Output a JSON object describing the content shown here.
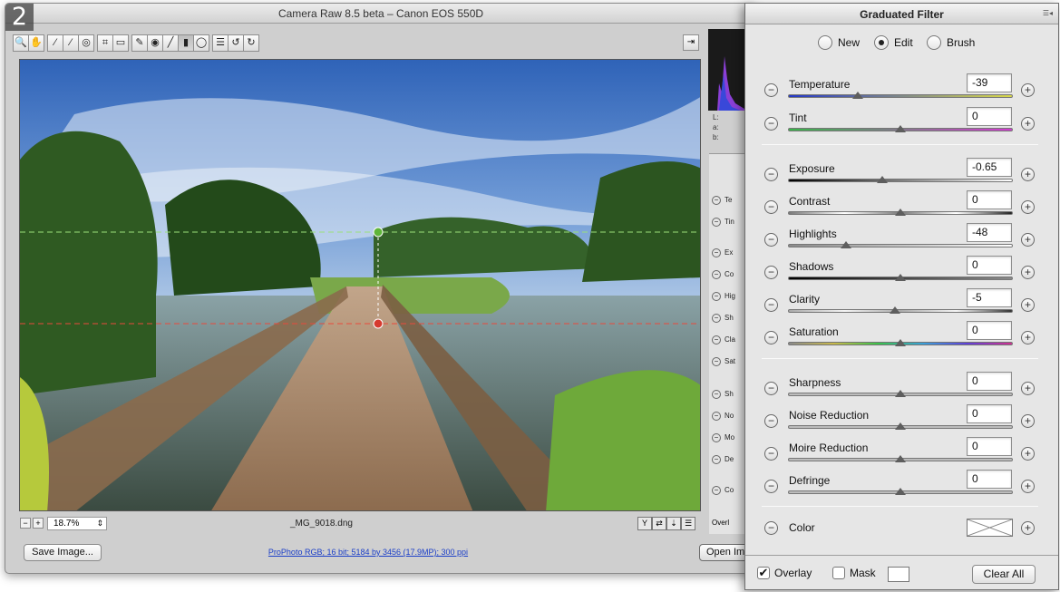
{
  "window": {
    "title": "Camera Raw 8.5 beta  –  Canon EOS 550D",
    "step_badge": "2"
  },
  "toolbar": {
    "tools": [
      {
        "icon": "zoom-icon",
        "glyph": "🔍"
      },
      {
        "icon": "hand-icon",
        "glyph": "✋"
      },
      {
        "icon": "white-balance-icon",
        "glyph": "⁄"
      },
      {
        "icon": "color-sampler-icon",
        "glyph": "⁄"
      },
      {
        "icon": "targeted-adjustment-icon",
        "glyph": "◎"
      },
      {
        "icon": "crop-icon",
        "glyph": "⌗"
      },
      {
        "icon": "straighten-icon",
        "glyph": "▭"
      },
      {
        "icon": "spot-removal-icon",
        "glyph": "✎"
      },
      {
        "icon": "red-eye-icon",
        "glyph": "◉"
      },
      {
        "icon": "adjustment-brush-icon",
        "glyph": "╱"
      },
      {
        "icon": "graduated-filter-icon",
        "glyph": "▮"
      },
      {
        "icon": "radial-filter-icon",
        "glyph": "◯"
      },
      {
        "icon": "preferences-icon",
        "glyph": "☰"
      },
      {
        "icon": "rotate-left-icon",
        "glyph": "↺"
      },
      {
        "icon": "rotate-right-icon",
        "glyph": "↻"
      }
    ],
    "open_prefs_glyph": "⇥"
  },
  "status": {
    "zoom_out": "−",
    "zoom_in": "+",
    "zoom_value": "18.7%",
    "zoom_arrow": "⇕",
    "filename": "_MG_9018.dng"
  },
  "footer": {
    "save_label": "Save Image...",
    "workflow_link": "ProPhoto RGB; 16 bit; 5184 by 3456 (17.9MP); 300 ppi",
    "open_label": "Open Im"
  },
  "behind": {
    "lab": [
      "L:",
      "a:",
      "b:"
    ],
    "rows": [
      "Te",
      "Tin",
      "Ex",
      "Co",
      "Hig",
      "Sh",
      "Cla",
      "Sat",
      "Sh",
      "No",
      "Mo",
      "De",
      "Co"
    ],
    "overlay": "Overl"
  },
  "panel": {
    "title": "Graduated Filter",
    "menu_glyph": "☰◂",
    "modes": [
      {
        "label": "New",
        "selected": false
      },
      {
        "label": "Edit",
        "selected": true
      },
      {
        "label": "Brush",
        "selected": false
      }
    ],
    "groups": [
      [
        {
          "label": "Temperature",
          "value": "-39",
          "position": 0.31,
          "track": "temperature"
        },
        {
          "label": "Tint",
          "value": "0",
          "position": 0.5,
          "track": "tint"
        }
      ],
      [
        {
          "label": "Exposure",
          "value": "-0.65",
          "position": 0.42,
          "track": "exposure"
        },
        {
          "label": "Contrast",
          "value": "0",
          "position": 0.5,
          "track": "contrast"
        },
        {
          "label": "Highlights",
          "value": "-48",
          "position": 0.26,
          "track": "highlights"
        },
        {
          "label": "Shadows",
          "value": "0",
          "position": 0.5,
          "track": "shadows"
        },
        {
          "label": "Clarity",
          "value": "-5",
          "position": 0.475,
          "track": "clarity"
        },
        {
          "label": "Saturation",
          "value": "0",
          "position": 0.5,
          "track": "saturation"
        }
      ],
      [
        {
          "label": "Sharpness",
          "value": "0",
          "position": 0.5,
          "track": "plain"
        },
        {
          "label": "Noise Reduction",
          "value": "0",
          "position": 0.5,
          "track": "plain"
        },
        {
          "label": "Moire Reduction",
          "value": "0",
          "position": 0.5,
          "track": "plain"
        },
        {
          "label": "Defringe",
          "value": "0",
          "position": 0.5,
          "track": "plain"
        }
      ]
    ],
    "color_label": "Color",
    "overlay_label": "Overlay",
    "overlay_checked": true,
    "mask_label": "Mask",
    "mask_checked": false,
    "clear_all_label": "Clear All",
    "minus_glyph": "−",
    "plus_glyph": "+"
  },
  "colors": {
    "start_pin": "#5fb53a",
    "end_pin": "#d63a2e",
    "start_line": "#9be07a",
    "end_line": "#e84a3c"
  }
}
